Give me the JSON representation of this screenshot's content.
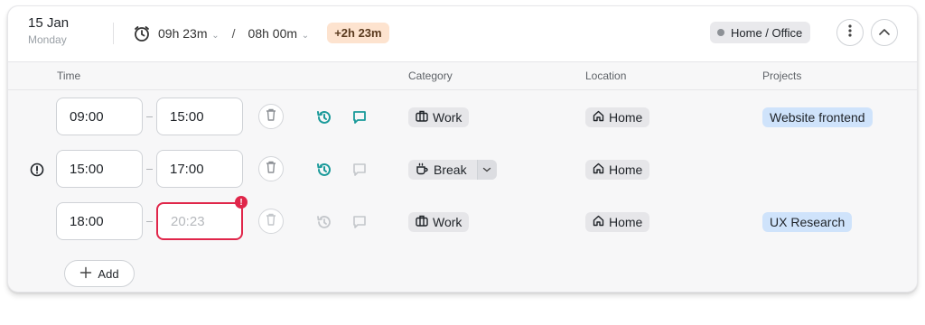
{
  "header": {
    "date": "15 Jan",
    "weekday": "Monday",
    "tracked": "09h 23m",
    "target": "08h 00m",
    "separator": "/",
    "overtime": "+2h 23m",
    "location": "Home / Office",
    "icons": [
      "stopwatch-icon",
      "more-vertical-icon",
      "chevron-up-icon"
    ]
  },
  "columns": {
    "time": "Time",
    "category": "Category",
    "location": "Location",
    "projects": "Projects"
  },
  "entries": [
    {
      "start": "09:00",
      "end": "15:00",
      "category": "Work",
      "location": "Home",
      "project": "Website frontend"
    },
    {
      "start": "15:00",
      "end": "17:00",
      "category": "Break",
      "location": "Home",
      "project": ""
    },
    {
      "start": "18:00",
      "end": "20:23",
      "category": "Work",
      "location": "Home",
      "project": "UX Research"
    }
  ],
  "add_label": "Add",
  "colors": {
    "accent": "#1a9a9a",
    "error": "#e0264a",
    "overtime_bg": "#fde3cf",
    "project_bg": "#cfe3fb",
    "chip_bg": "#e6e6e9"
  }
}
